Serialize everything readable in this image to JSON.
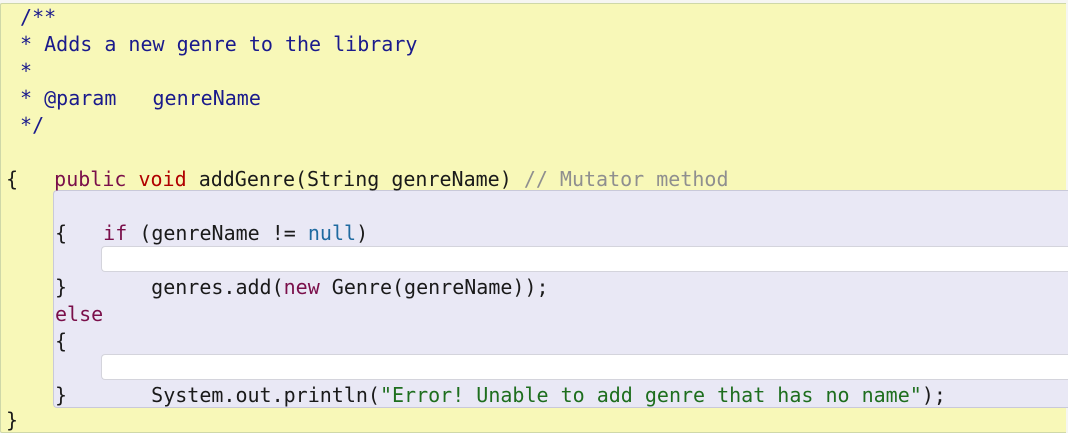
{
  "editor": {
    "javadoc": {
      "open": " /**",
      "desc": " * Adds a new genre to the library",
      "blank": " *",
      "param": " * @param   genreName",
      "close": " */"
    },
    "signature": {
      "kw_public": "public",
      "kw_void": "void",
      "rest": "addGenre(String genreName)",
      "comment": "// Mutator method"
    },
    "brace_open": "{",
    "brace_close": "}",
    "if_block": {
      "kw_if": "if",
      "cond_start": "(genreName != ",
      "kw_null": "null",
      "cond_end": ")",
      "brace_open": "{",
      "stmt_start": "genres.add(",
      "kw_new": "new",
      "stmt_end": " Genre(genreName));",
      "brace_close": "}"
    },
    "else_block": {
      "kw_else": "else",
      "brace_open": "{",
      "stmt_start": "System.out.println(",
      "string": "\"Error! Unable to add genre that has no name\"",
      "stmt_end": ");",
      "brace_close": "}"
    }
  },
  "colors": {
    "method_scope": "#f8f8b8",
    "if_scope": "#e9e8f5",
    "inner_scope": "#ffffff",
    "javadoc": "#1a1a8c",
    "comment": "#8f8f8f",
    "keyword": "#7a0f4a",
    "keyword_modifier": "#b00000",
    "literal_null": "#1f6aa0",
    "string": "#1e6e1e"
  }
}
